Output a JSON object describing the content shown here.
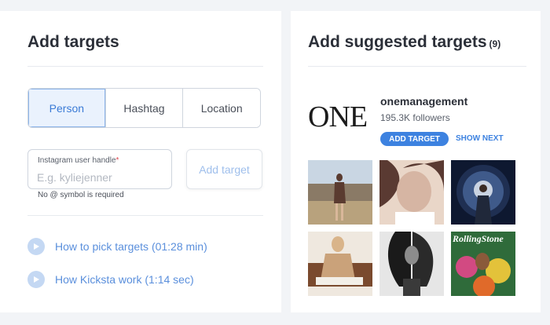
{
  "add_targets": {
    "title": "Add targets",
    "tabs": [
      {
        "label": "Person",
        "active": true
      },
      {
        "label": "Hashtag",
        "active": false
      },
      {
        "label": "Location",
        "active": false
      }
    ],
    "handle_input": {
      "label": "Instagram user handle",
      "required_mark": "*",
      "placeholder": "E.g. kyliejenner",
      "value": ""
    },
    "hint": "No @ symbol is required",
    "add_button": "Add target",
    "video_links": [
      {
        "label": "How to pick targets (01:28 min)",
        "icon": "play-icon"
      },
      {
        "label": "How Kicksta work (1:14 sec)",
        "icon": "play-icon"
      }
    ]
  },
  "suggested": {
    "title": "Add suggested targets",
    "count": "(9)",
    "account": {
      "logo_text": "ONE",
      "name": "onemanagement",
      "followers": "195.3K followers",
      "add_button": "ADD TARGET",
      "next_button": "SHOW NEXT"
    },
    "thumbnails": [
      {
        "name": "post-photo-1",
        "palette": [
          "#8a7a66",
          "#b8a27d",
          "#5a3b30"
        ]
      },
      {
        "name": "post-photo-2",
        "palette": [
          "#d6b5a3",
          "#5a3a32",
          "#e9d6c8"
        ]
      },
      {
        "name": "post-photo-3",
        "palette": [
          "#0e1830",
          "#3f5a8a",
          "#c9d3e2"
        ]
      },
      {
        "name": "post-photo-4",
        "palette": [
          "#efe8df",
          "#caa27a",
          "#7a4a2e"
        ]
      },
      {
        "name": "post-photo-5",
        "palette": [
          "#e6e6e6",
          "#1a1a1a",
          "#8c8c8c"
        ]
      },
      {
        "name": "post-photo-6",
        "palette": [
          "#2f6b3a",
          "#d24a82",
          "#e3c23a"
        ]
      }
    ],
    "magazine_label": "RollingStone"
  },
  "colors": {
    "accent": "#3d82e0",
    "link": "#5a8fdc",
    "active_tab_bg": "#eaf2fd"
  }
}
